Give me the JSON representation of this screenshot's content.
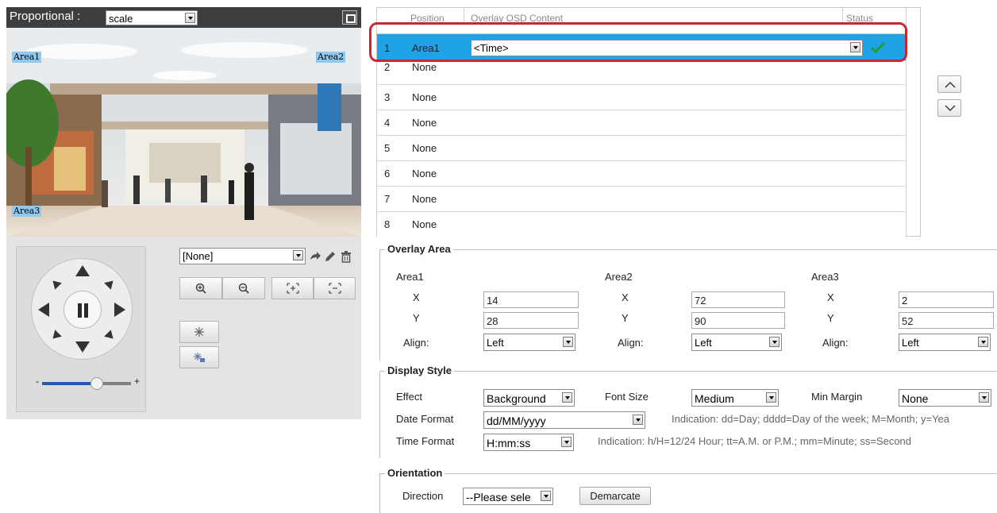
{
  "video": {
    "proportional_label": "Proportional :",
    "scale_value": "scale",
    "area_tags": [
      "Area1",
      "Area2",
      "Area3"
    ]
  },
  "ptz": {
    "preset_value": "[None]",
    "zoom_level": 0.62,
    "zoom_minus": "-",
    "zoom_plus": "+"
  },
  "osd_table": {
    "headers": {
      "position": "Position",
      "content": "Overlay OSD Content",
      "status": "Status"
    },
    "rows": [
      {
        "num": "1",
        "position": "Area1",
        "content": "<Time>"
      },
      {
        "num": "2",
        "position": "None"
      },
      {
        "num": "3",
        "position": "None"
      },
      {
        "num": "4",
        "position": "None"
      },
      {
        "num": "5",
        "position": "None"
      },
      {
        "num": "6",
        "position": "None"
      },
      {
        "num": "7",
        "position": "None"
      },
      {
        "num": "8",
        "position": "None"
      }
    ]
  },
  "overlay_area": {
    "title": "Overlay Area",
    "areas": [
      {
        "name": "Area1",
        "x_label": "X",
        "x": "14",
        "y_label": "Y",
        "y": "28",
        "align_label": "Align:",
        "align": "Left"
      },
      {
        "name": "Area2",
        "x_label": "X",
        "x": "72",
        "y_label": "Y",
        "y": "90",
        "align_label": "Align:",
        "align": "Left"
      },
      {
        "name": "Area3",
        "x_label": "X",
        "x": "2",
        "y_label": "Y",
        "y": "52",
        "align_label": "Align:",
        "align": "Left"
      }
    ]
  },
  "display_style": {
    "title": "Display Style",
    "effect_label": "Effect",
    "effect_value": "Background",
    "font_size_label": "Font Size",
    "font_size_value": "Medium",
    "min_margin_label": "Min Margin",
    "min_margin_value": "None",
    "date_format_label": "Date Format",
    "date_format_value": "dd/MM/yyyy",
    "date_hint": "Indication: dd=Day; dddd=Day of the week; M=Month; y=Yea",
    "time_format_label": "Time Format",
    "time_format_value": "H:mm:ss",
    "time_hint": "Indication: h/H=12/24 Hour; tt=A.M. or P.M.; mm=Minute; ss=Second"
  },
  "orientation": {
    "title": "Orientation",
    "direction_label": "Direction",
    "direction_value": "--Please sele",
    "demarcate_label": "Demarcate"
  },
  "colors": {
    "selected_row": "#1fa3e6",
    "highlight_ring": "#c8282e",
    "status_ok": "#1e9e2a"
  }
}
